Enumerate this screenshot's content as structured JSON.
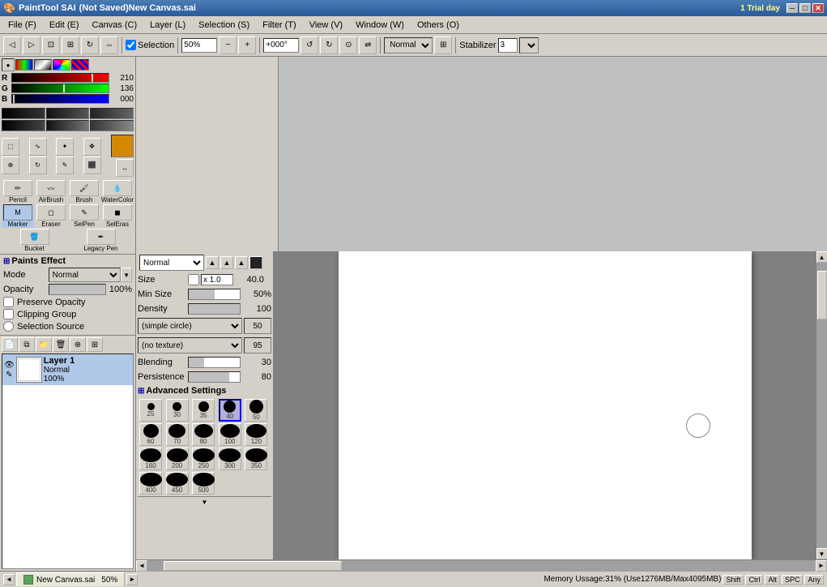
{
  "app": {
    "title": "PaintTool SAI",
    "subtitle": "(Not Saved)New Canvas.sai",
    "trial_info": "1 Trial day"
  },
  "titlebar": {
    "minimize": "─",
    "maximize": "□",
    "close": "✕"
  },
  "menubar": {
    "items": [
      {
        "label": "File (F)"
      },
      {
        "label": "Edit (E)"
      },
      {
        "label": "Canvas (C)"
      },
      {
        "label": "Layer (L)"
      },
      {
        "label": "Selection (S)"
      },
      {
        "label": "Filter (T)"
      },
      {
        "label": "View (V)"
      },
      {
        "label": "Window (W)"
      },
      {
        "label": "Others (O)"
      }
    ]
  },
  "toolbar": {
    "selection_checked": true,
    "selection_label": "Selection",
    "zoom": "50%",
    "rotation": "+000°",
    "mode": "Normal",
    "stabilizer_label": "Stabilizer",
    "stabilizer_val": "3"
  },
  "color": {
    "r_val": "210",
    "g_val": "136",
    "b_val": "000",
    "r_pct": 82,
    "g_pct": 53,
    "b_pct": 0,
    "current": "#d48800"
  },
  "gradients": [
    {
      "from": "#000",
      "to": "#333"
    },
    {
      "from": "#333",
      "to": "#666"
    },
    {
      "from": "#000",
      "to": "#444"
    },
    {
      "from": "#000",
      "to": "#555"
    },
    {
      "from": "#222",
      "to": "#888"
    },
    {
      "from": "#444",
      "to": "#999"
    }
  ],
  "tools": {
    "secondary": [
      {
        "symbol": "◻",
        "name": "selection-rect"
      },
      {
        "symbol": "⬚",
        "name": "selection-lasso"
      },
      {
        "symbol": "✦",
        "name": "magic-wand"
      },
      {
        "symbol": "✥",
        "name": "move"
      },
      {
        "symbol": "⊕",
        "name": "zoom-in"
      },
      {
        "symbol": "↻",
        "name": "rotate"
      },
      {
        "symbol": "◍",
        "name": "eyedrop"
      },
      {
        "symbol": "✎",
        "name": "pen"
      },
      {
        "symbol": "🪣",
        "name": "fill"
      }
    ]
  },
  "brush_tools": [
    {
      "label": "Pencil",
      "symbol": "✏"
    },
    {
      "label": "AirBrush",
      "symbol": "〰"
    },
    {
      "label": "Brush",
      "symbol": "🖌"
    },
    {
      "label": "WaterColor",
      "symbol": "💧"
    },
    {
      "label": "Marker",
      "symbol": "M",
      "active": true
    },
    {
      "label": "Eraser",
      "symbol": "◻"
    },
    {
      "label": "SelPen",
      "symbol": "✏"
    },
    {
      "label": "SelEras",
      "symbol": "◻"
    },
    {
      "label": "Bucket",
      "symbol": "🪣"
    },
    {
      "label": "Legacy Pen",
      "symbol": "✏"
    }
  ],
  "paints_effect": {
    "title": "Paints Effect",
    "mode_label": "Mode",
    "mode_val": "Normal",
    "opacity_label": "Opacity",
    "opacity_val": "100%",
    "opacity_pct": 100,
    "preserve_opacity_label": "Preserve Opacity",
    "clipping_group_label": "Clipping Group",
    "selection_source_label": "Selection Source"
  },
  "layers": {
    "items": [
      {
        "name": "Layer 1",
        "mode": "Normal",
        "opacity": "100%",
        "active": true
      }
    ]
  },
  "brush_mode": {
    "mode": "Normal",
    "size_label": "Size",
    "size_val": "40.0",
    "size_mult": "x 1.0",
    "min_size_label": "Min Size",
    "min_size_val": "50%",
    "min_size_pct": 50,
    "density_label": "Density",
    "density_val": "100",
    "density_pct": 100,
    "shape_label": "(simple circle)",
    "texture_label": "(no texture)",
    "shape_val": "50",
    "texture_val": "95",
    "blending_label": "Blending",
    "blending_val": "30",
    "blending_pct": 30,
    "persistence_label": "Persistence",
    "persistence_val": "80",
    "persistence_pct": 80,
    "advanced_label": "Advanced Settings"
  },
  "brush_sizes": [
    {
      "size": 25,
      "r": 9
    },
    {
      "size": 30,
      "r": 11
    },
    {
      "size": 35,
      "r": 13
    },
    {
      "size": 40,
      "r": 15,
      "active": true
    },
    {
      "size": 50,
      "r": 17
    },
    {
      "size": 60,
      "r": 19
    },
    {
      "size": 70,
      "r": 21
    },
    {
      "size": 80,
      "r": 23
    },
    {
      "size": 100,
      "r": 25
    },
    {
      "size": 120,
      "r": 26
    },
    {
      "size": 160,
      "r": 27
    },
    {
      "size": 200,
      "r": 28
    },
    {
      "size": 250,
      "r": 28
    },
    {
      "size": 300,
      "r": 28
    },
    {
      "size": 350,
      "r": 28
    },
    {
      "size": 400,
      "r": 28
    },
    {
      "size": 450,
      "r": 28
    },
    {
      "size": 500,
      "r": 28
    }
  ],
  "canvas_tab": {
    "name": "New Canvas.sai",
    "zoom": "50%"
  },
  "status": {
    "memory": "Memory Ussage:31% (Use1276MB/Max4095MB)",
    "keys": [
      "Shift",
      "Ctrl",
      "Alt",
      "SPC",
      "Any"
    ]
  }
}
